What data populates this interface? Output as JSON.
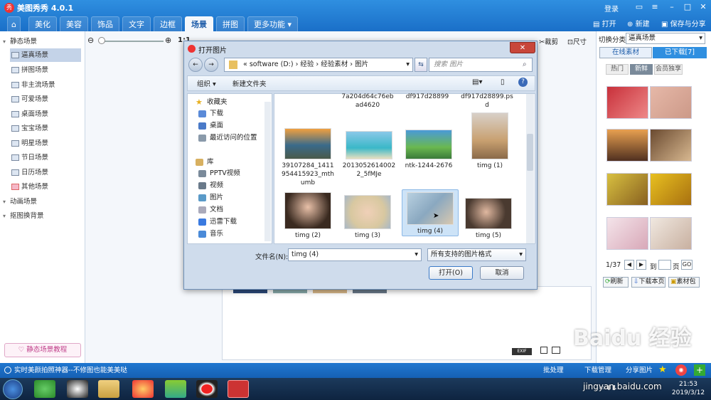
{
  "app": {
    "title": "美图秀秀 4.0.1",
    "logo": "秀",
    "login": "登录"
  },
  "tabs": [
    {
      "label": "美化"
    },
    {
      "label": "美容"
    },
    {
      "label": "饰品"
    },
    {
      "label": "文字"
    },
    {
      "label": "边框"
    },
    {
      "label": "场景"
    },
    {
      "label": "拼图"
    },
    {
      "label": "更多功能 ▾"
    }
  ],
  "home_icon": "home-icon",
  "right_tools": {
    "open": "打开",
    "new": "新建",
    "save": "保存与分享"
  },
  "left_panel": {
    "static_group": "静态场景",
    "items": [
      "逼真场景",
      "拼图场景",
      "非主流场景",
      "可爱场景",
      "桌面场景",
      "宝宝场景",
      "明星场景",
      "节日场景",
      "日历场景",
      "其他场景"
    ],
    "animated_group": "动画场景",
    "bg_group": "抠图换背景",
    "tutorial": "♡ 静态场景教程"
  },
  "center_toolbar": {
    "zoom_ratio": "1:1",
    "crop": "裁剪",
    "size": "尺寸"
  },
  "right_panel": {
    "category_label": "切换分类",
    "category_value": "逼真场景",
    "tab_online": "在线素材",
    "tab_downloaded": "已下载[7]",
    "filters": [
      "热门",
      "新鲜",
      "会员独享"
    ],
    "page": "1/37",
    "goto_label": "到",
    "page_unit": "页",
    "go": "GO",
    "refresh": "刷新",
    "download_page": "下载本页",
    "library": "素材包"
  },
  "status_bar": {
    "text": "实时美颜拍照神器--不修图也能美美哒",
    "batch": "批处理",
    "download_mgr": "下载管理",
    "share": "分享图片",
    "exif": "EXIF"
  },
  "dialog": {
    "title": "打开图片",
    "address": "« software (D:) › 经验 › 经验素材 › 图片",
    "search_placeholder": "搜索 图片",
    "organize": "组织 ▾",
    "new_folder": "新建文件夹",
    "nav": {
      "favorites": "收藏夹",
      "download": "下载",
      "desktop": "桌面",
      "recent": "最近访问的位置",
      "library": "库",
      "pptv": "PPTV视频",
      "video": "视频",
      "pictures": "图片",
      "documents": "文档",
      "xunlei": "迅雷下载",
      "music": "音乐"
    },
    "files_top": [
      "7a204d64c76eb\nad4620",
      "df917d28899",
      "df917d28899.ps\nd"
    ],
    "files_row1": [
      "39107284_1411\n954415923_mth\numb",
      "2013052614002\n2_5fMJe",
      "ntk-1244-2676",
      "timg (1)"
    ],
    "files_row2": [
      "timg (2)",
      "timg (3)",
      "timg (4)",
      "timg (5)"
    ],
    "filename_label": "文件名(N):",
    "filename_value": "timg (4)",
    "filetype_value": "所有支持的图片格式",
    "open_btn": "打开(O)",
    "cancel_btn": "取消"
  },
  "taskbar": {
    "time": "21:53",
    "date": "2019/3/12"
  },
  "watermark": {
    "text": "Baidu 经验",
    "url": "jingyan.baidu.com"
  }
}
